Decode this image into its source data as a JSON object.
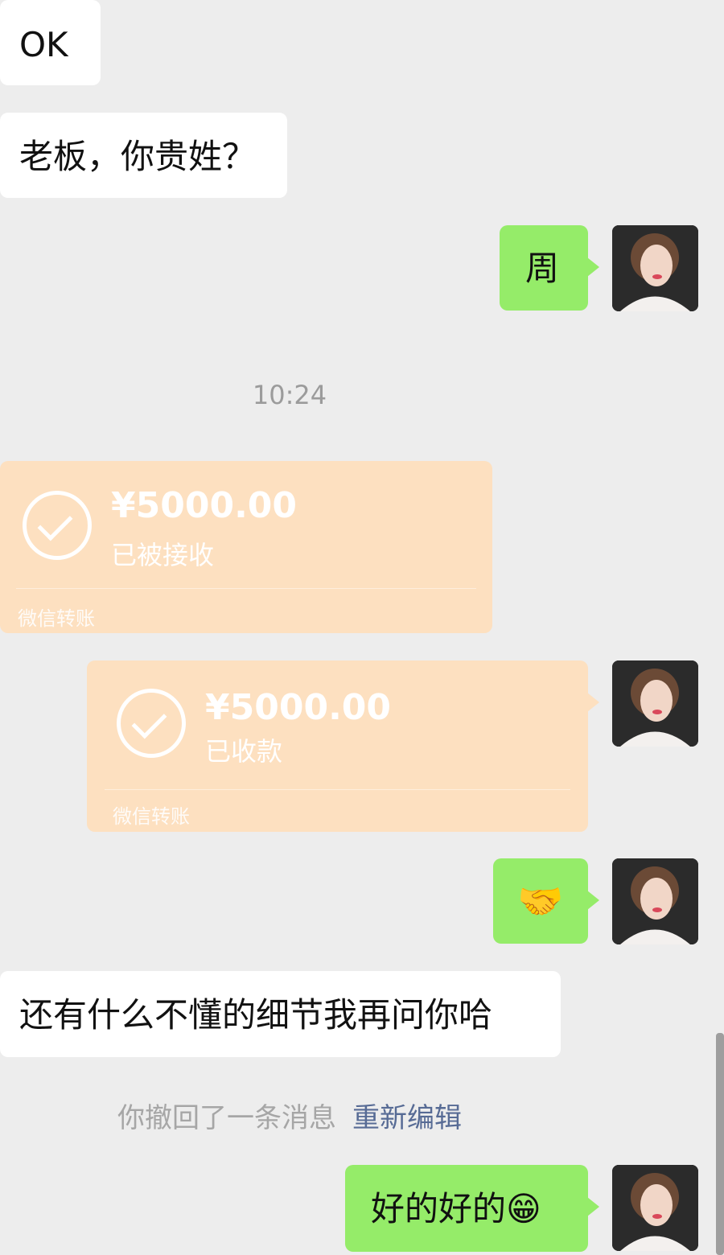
{
  "messages": {
    "m1_text": "OK",
    "m2_text": "老板，你贵姓？",
    "m3_text": "周",
    "timestamp": "10:24",
    "transfer_in": {
      "amount": "¥5000.00",
      "status": "已被接收",
      "label": "微信转账"
    },
    "transfer_out": {
      "amount": "¥5000.00",
      "status": "已收款",
      "label": "微信转账"
    },
    "m4_emoji": "🤝",
    "m5_text": "还有什么不懂的细节我再问你哈",
    "recall_notice": "你撤回了一条消息",
    "recall_edit": "重新编辑",
    "m6_text": "好的好的😁"
  },
  "colors": {
    "background": "#ededed",
    "incoming_bubble": "#ffffff",
    "outgoing_bubble": "#95ec69",
    "transfer_bubble": "#fde0c0",
    "edit_link": "#576b95"
  },
  "icons": {
    "avatar": "user-avatar",
    "transfer_check": "check-circle-icon"
  }
}
